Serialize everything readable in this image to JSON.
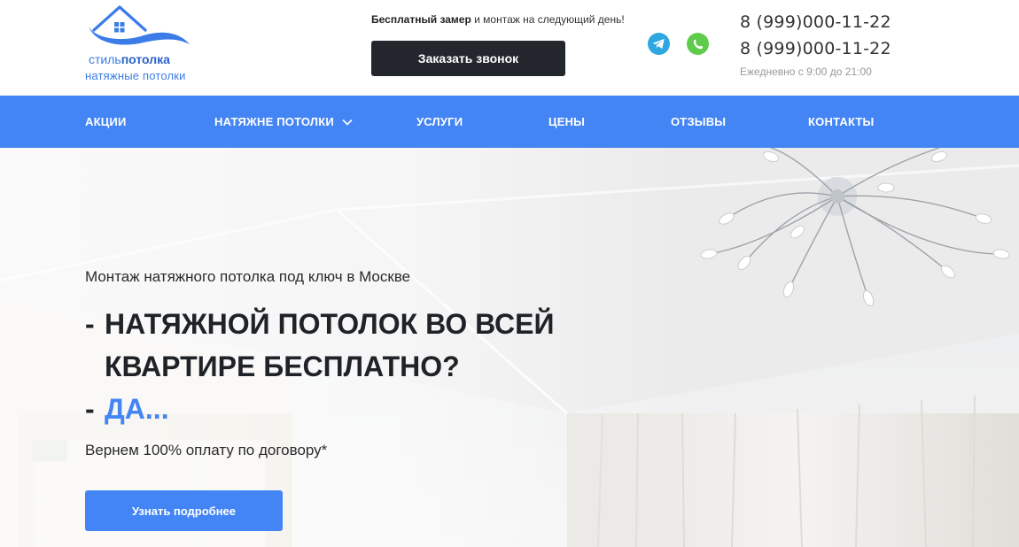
{
  "brand": {
    "logo_word1": "стиль",
    "logo_word2": "потолка",
    "tagline": "натяжные потолки",
    "color": "#3b7ce8"
  },
  "header": {
    "promo_bold": "Бесплатный замер",
    "promo_rest": " и монтаж на следующий день!",
    "call_button": "Заказать звонок",
    "messengers": [
      {
        "icon": "telegram-icon",
        "color": "#2ea6e0"
      },
      {
        "icon": "whatsapp-icon",
        "color": "#5fcb4a"
      }
    ],
    "phone1": "8 (999)000-11-22",
    "phone2": "8 (999)000-11-22",
    "hours": "Ежедневно с 9:00 до 21:00"
  },
  "nav": {
    "items": [
      {
        "label": "АКЦИИ"
      },
      {
        "label": "НАТЯЖНЕ ПОТОЛКИ",
        "icon": "chevron-down-icon"
      },
      {
        "label": "УСЛУГИ"
      },
      {
        "label": "ЦЕНЫ"
      },
      {
        "label": "ОТЗЫВЫ"
      },
      {
        "label": "КОНТАКТЫ"
      }
    ],
    "color": "#4485f5"
  },
  "hero": {
    "subtitle": "Монтаж натяжного потолка под ключ в Москве",
    "dash": "-",
    "title_line1": "НАТЯЖНОЙ ПОТОЛОК ВО ВСЕЙ",
    "title_line2": "КВАРТИРЕ БЕСПЛАТНО?",
    "title_line3": "ДА...",
    "note": "Вернем 100% оплату по договору*",
    "button": "Узнать подробнее",
    "accent_color": "#4485f5"
  }
}
